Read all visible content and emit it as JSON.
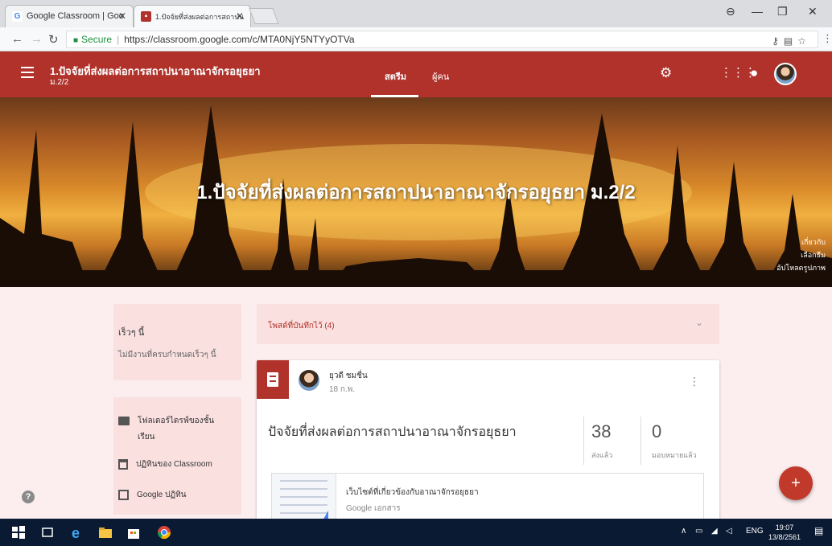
{
  "browser": {
    "tabs": [
      {
        "label": "Google Classroom | Goo",
        "active": false
      },
      {
        "label": "1.ปัจจัยที่ส่งผลต่อการสถาปน",
        "active": true
      }
    ],
    "secure_label": "Secure",
    "url": "https://classroom.google.com/c/MTA0NjY5NTYyOTVa"
  },
  "appbar": {
    "class_title": "1.ปัจจัยที่ส่งผลต่อการสถาปนาอาณาจักรอยุธยา",
    "class_section": "ม.2/2",
    "tabs": [
      "สตรีม",
      "ผู้คน"
    ],
    "active_tab": "สตรีม"
  },
  "banner": {
    "title": "1.ปัจจัยที่ส่งผลต่อการสถาปนาอาณาจักรอยุธยา ม.2/2",
    "links": [
      "เกี่ยวกับ",
      "เลือกธีม",
      "อัปโหลดรูปภาพ"
    ]
  },
  "sidebar": {
    "upcoming_heading": "เร็วๆ นี้",
    "upcoming_text": "ไม่มีงานที่ครบกำหนดเร็วๆ นี้",
    "folder_label_line1": "โฟลเดอร์ไดรฟ์ของชั้น",
    "folder_label_line2": "เรียน",
    "calendar_label": "ปฏิทินของ Classroom",
    "gcal_label": "Google ปฏิทิน"
  },
  "stream": {
    "saved_posts_label": "โพสต์ที่บันทึกไว้ (4)",
    "post": {
      "author": "ยุวดี ชมชื่น",
      "date": "18 ก.พ.",
      "title": "ปัจจัยที่ส่งผลต่อการสถาปนาอาณาจักรอยุธยา",
      "turned_in_count": "38",
      "turned_in_label": "ส่งแล้ว",
      "assigned_count": "0",
      "assigned_label": "มอบหมายแล้ว",
      "attachment_title": "เว็บไซต์ที่เกี่ยวข้องกับอาณาจักรอยุธยา",
      "attachment_type": "Google เอกสาร"
    }
  },
  "taskbar": {
    "lang": "ENG",
    "time": "19:07",
    "date": "13/8/2561"
  },
  "colors": {
    "brand": "#b0322b",
    "page_bg": "#fceeee",
    "card_bg": "#fbe0e0"
  }
}
